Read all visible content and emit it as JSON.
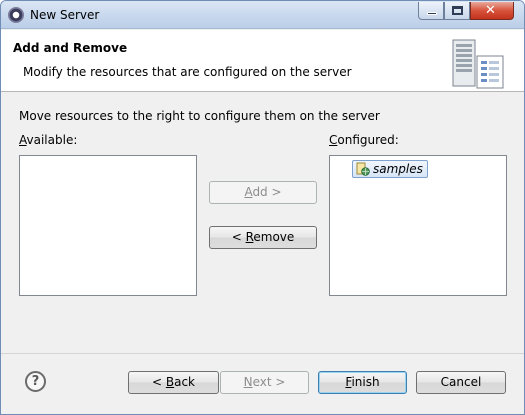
{
  "window": {
    "title": "New Server",
    "app_icon": "eclipse-icon",
    "controls": {
      "minimize": "minimize-icon",
      "maximize": "maximize-icon",
      "close": "close-icon"
    }
  },
  "banner": {
    "title": "Add and Remove",
    "description": "Modify the resources that are configured on the server",
    "image": "server-icon"
  },
  "instruction": "Move resources to the right to configure them on the server",
  "available": {
    "label_mnemonic": "A",
    "label_rest": "vailable:",
    "items": []
  },
  "configured": {
    "label_mnemonic": "C",
    "label_rest": "onfigured:",
    "items": [
      {
        "label": "samples",
        "icon": "web-module-icon",
        "selected": true
      }
    ]
  },
  "buttons": {
    "add": {
      "mnemonic": "A",
      "rest": "dd >",
      "enabled": false
    },
    "remove": {
      "prefix": "< ",
      "mnemonic": "R",
      "rest": "emove",
      "enabled": true
    },
    "back": {
      "prefix": "< ",
      "mnemonic": "B",
      "rest": "ack",
      "enabled": true
    },
    "next": {
      "mnemonic": "N",
      "rest": "ext >",
      "enabled": false
    },
    "finish": {
      "mnemonic": "F",
      "rest": "inish",
      "enabled": true,
      "default": true
    },
    "cancel": {
      "label": "Cancel",
      "enabled": true
    }
  },
  "help_icon": "?"
}
